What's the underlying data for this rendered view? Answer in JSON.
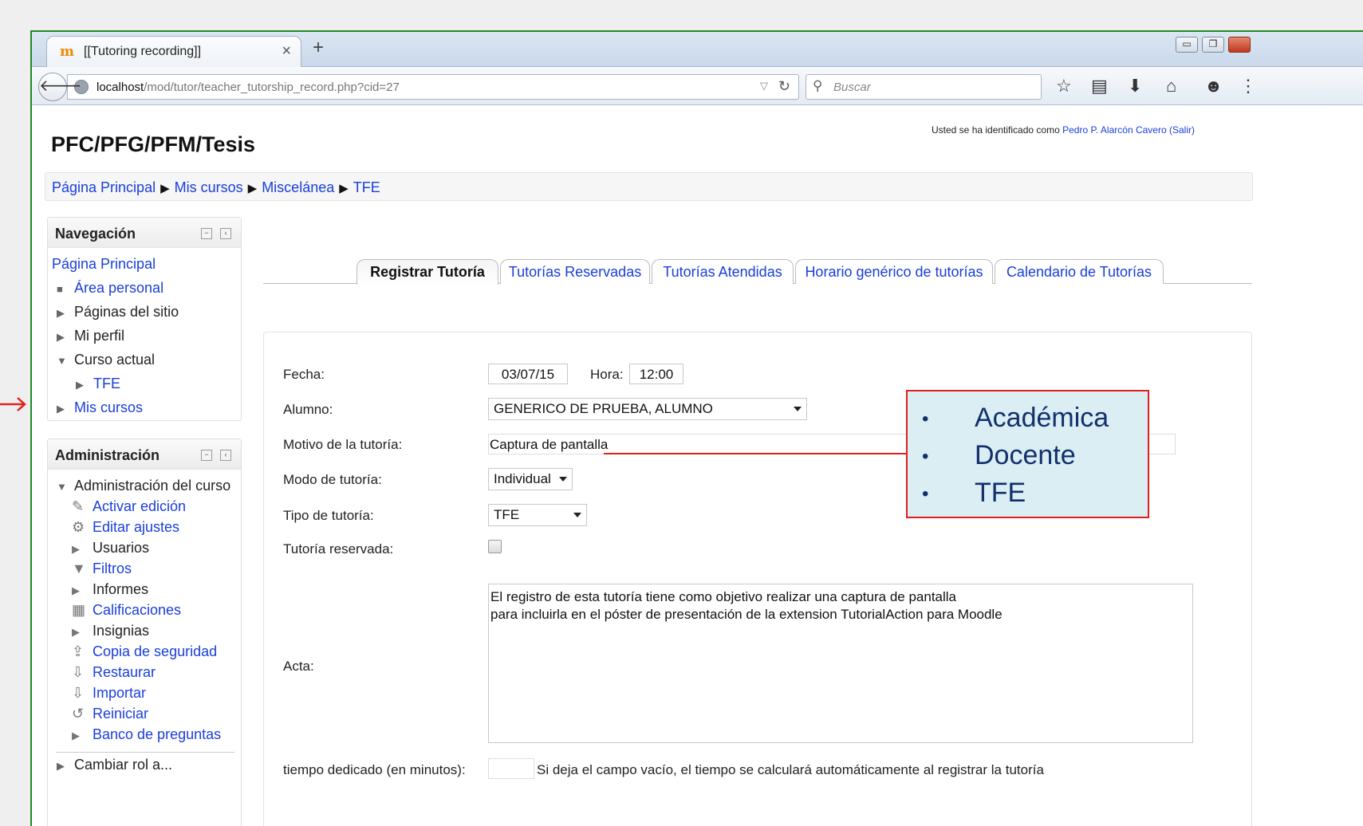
{
  "browser": {
    "tab_title": "[[Tutoring recording]]",
    "tab_favicon": "moodle-icon",
    "tab_close": "×",
    "new_tab": "+",
    "url_host": "localhost",
    "url_path": "/mod/tutor/teacher_tutorship_record.php?cid=27",
    "search_placeholder": "Buscar"
  },
  "header": {
    "site_title": "PFC/PFG/PFM/Tesis",
    "login_prefix": "Usted se ha identificado como",
    "login_user": "Pedro P. Alarcón Cavero",
    "login_logout": "(Salir)"
  },
  "breadcrumb": [
    "Página Principal",
    "Mis cursos",
    "Miscelánea",
    "TFE"
  ],
  "navigation": {
    "title": "Navegación",
    "items": [
      "Página Principal",
      "Área personal",
      "Páginas del sitio",
      "Mi perfil",
      "Curso actual",
      "TFE",
      "Mis cursos"
    ]
  },
  "administration": {
    "title": "Administración",
    "course_admin": "Administración del curso",
    "items": [
      "Activar edición",
      "Editar ajustes",
      "Usuarios",
      "Filtros",
      "Informes",
      "Calificaciones",
      "Insignias",
      "Copia de seguridad",
      "Restaurar",
      "Importar",
      "Reiniciar",
      "Banco de preguntas"
    ],
    "cut_item": "Cambiar rol a..."
  },
  "tabs": [
    "Registrar Tutoría",
    "Tutorías Reservadas",
    "Tutorías Atendidas",
    "Horario genérico de tutorías",
    "Calendario de Tutorías"
  ],
  "form": {
    "fecha_label": "Fecha:",
    "fecha_value": "03/07/15",
    "hora_label": "Hora:",
    "hora_value": "12:00",
    "alumno_label": "Alumno:",
    "alumno_value": "GENERICO DE PRUEBA, ALUMNO",
    "motivo_label": "Motivo de la tutoría:",
    "motivo_value": "Captura de  pantalla",
    "modo_label": "Modo de tutoría:",
    "modo_value": "Individual",
    "tipo_label": "Tipo de tutoría:",
    "tipo_value": "TFE",
    "reservada_label": "Tutoría reservada:",
    "acta_label": "Acta:",
    "acta_line1": "El registro de esta tutoría tiene como objetivo  realizar una captura de pantalla",
    "acta_line2": "para incluirla en el póster de presentación de la extension TutorialAction para Moodle",
    "tiempo_label": "tiempo dedicado (en minutos):",
    "tiempo_hint": "Si deja el campo vacío, el tiempo se calculará automáticamente al registrar la tutoría"
  },
  "callout": {
    "items": [
      "Académica",
      "Docente",
      "TFE"
    ]
  },
  "colors": {
    "link": "#1a3eda",
    "callout_border": "#e0201b",
    "callout_bg": "#dbeef4",
    "callout_text": "#12306d",
    "window_border": "#1f8a1f"
  }
}
